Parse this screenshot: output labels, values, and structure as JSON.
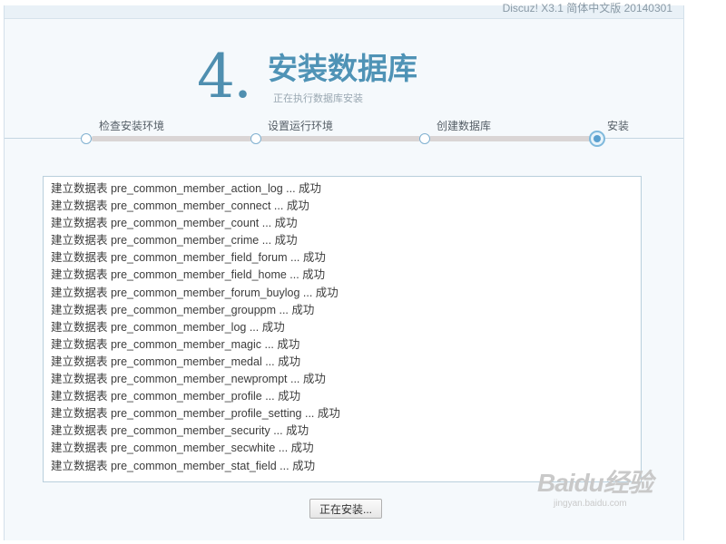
{
  "header": {
    "version_text": "Discuz! X3.1 简体中文版 20140301"
  },
  "step": {
    "number": "4.",
    "title": "安装数据库",
    "subtitle": "正在执行数据库安装"
  },
  "steps": [
    {
      "label": "检查安装环境",
      "state": "done"
    },
    {
      "label": "设置运行环境",
      "state": "done"
    },
    {
      "label": "创建数据库",
      "state": "done"
    },
    {
      "label": "安装",
      "state": "current"
    }
  ],
  "log": {
    "lines": [
      "建立数据表 pre_common_member_action_log ... 成功",
      "建立数据表 pre_common_member_connect ... 成功",
      "建立数据表 pre_common_member_count ... 成功",
      "建立数据表 pre_common_member_crime ... 成功",
      "建立数据表 pre_common_member_field_forum ... 成功",
      "建立数据表 pre_common_member_field_home ... 成功",
      "建立数据表 pre_common_member_forum_buylog ... 成功",
      "建立数据表 pre_common_member_grouppm ... 成功",
      "建立数据表 pre_common_member_log ... 成功",
      "建立数据表 pre_common_member_magic ... 成功",
      "建立数据表 pre_common_member_medal ... 成功",
      "建立数据表 pre_common_member_newprompt ... 成功",
      "建立数据表 pre_common_member_profile ... 成功",
      "建立数据表 pre_common_member_profile_setting ... 成功",
      "建立数据表 pre_common_member_security ... 成功",
      "建立数据表 pre_common_member_secwhite ... 成功",
      "建立数据表 pre_common_member_stat_field ... 成功"
    ]
  },
  "status_button": {
    "label": "正在安装..."
  },
  "watermark": {
    "text": "Baidu经验",
    "url": "jingyan.baidu.com"
  },
  "colors": {
    "accent": "#4f93b6",
    "background": "#f5f9fc",
    "border": "#b9cfdc"
  }
}
